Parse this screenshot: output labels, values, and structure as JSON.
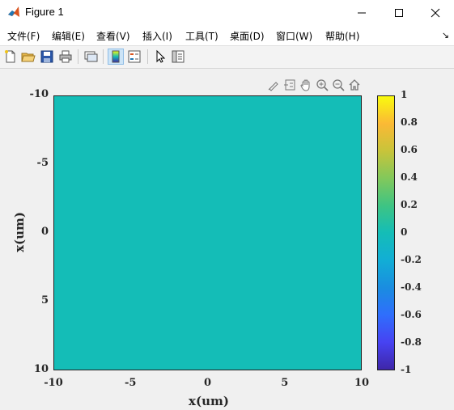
{
  "window": {
    "title": "Figure 1"
  },
  "menu": [
    "文件(F)",
    "编辑(E)",
    "查看(V)",
    "插入(I)",
    "工具(T)",
    "桌面(D)",
    "窗口(W)",
    "帮助(H)"
  ],
  "toolbar_icons": [
    "new-figure-icon",
    "open-file-icon",
    "save-icon",
    "print-icon",
    "link-plot-icon",
    "colorbar-icon",
    "legend-icon",
    "pointer-icon",
    "property-inspector-icon"
  ],
  "axes_toolbar_icons": [
    "brush-icon",
    "data-tips-icon",
    "pan-icon",
    "zoom-in-icon",
    "zoom-out-icon",
    "home-icon"
  ],
  "colors": {
    "field": "#14bdb7"
  },
  "chart_data": {
    "type": "heatmap",
    "xlabel": "x(um)",
    "ylabel": "x(um)",
    "xlim": [
      -10,
      10
    ],
    "ylim": [
      -10,
      10
    ],
    "y_reversed": true,
    "x_ticks": [
      "-10",
      "-5",
      "0",
      "5",
      "10"
    ],
    "y_ticks": [
      "-10",
      "-5",
      "0",
      "5",
      "10"
    ],
    "values_uniform": 0,
    "colorbar": {
      "range": [
        -1,
        1
      ],
      "ticks": [
        "1",
        "0.8",
        "0.6",
        "0.4",
        "0.2",
        "0",
        "-0.2",
        "-0.4",
        "-0.6",
        "-0.8",
        "-1"
      ],
      "colormap": "parula"
    }
  }
}
